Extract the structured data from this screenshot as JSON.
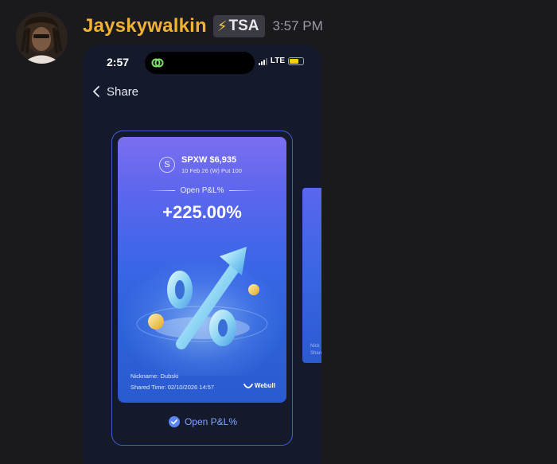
{
  "message": {
    "username": "Jayskywalkin",
    "tag": {
      "icon": "lightning-bolt-icon",
      "label": "TSA"
    },
    "timestamp": "3:57 PM"
  },
  "phone": {
    "status_bar": {
      "time": "2:57",
      "network": "LTE"
    },
    "nav": {
      "back_icon": "chevron-left-icon",
      "title": "Share"
    },
    "card": {
      "ticker": "SPXW $6,935",
      "coin_letter": "S",
      "contract": "10 Feb 26 (W) Put 100",
      "pnl_label": "Open P&L%",
      "pnl_value": "+225.00%",
      "nickname": "Nickname: Dubski",
      "shared_time": "Shared Time: 02/10/2026 14:57",
      "brand": "Webull"
    },
    "selected_option": "Open P&L%",
    "side_card_text": [
      "Nick",
      "Share"
    ]
  },
  "colors": {
    "username": "#f0b232",
    "background": "#1a1a1e",
    "accent": "#7fa4ff"
  }
}
